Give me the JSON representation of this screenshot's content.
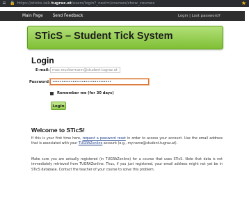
{
  "browser": {
    "menu_glyph": "≡",
    "lock_glyph": "🔒",
    "url_prefix": "https://sticks.iaik.",
    "url_domain": "tugraz.at",
    "url_suffix": "/users/login?_next=/courses/show_courses",
    "star_glyph": "★"
  },
  "navbar": {
    "main_page": "Main Page",
    "send_feedback": "Send Feedback",
    "login": "Login",
    "separator": " | ",
    "lost_password": "Lost password?"
  },
  "banner": {
    "title": "STicS – Student Tick System"
  },
  "login_form": {
    "heading": "Login",
    "email_label": "E-mail:",
    "email_placeholder": "max.muckermann@student.tugraz.at",
    "password_label": "Password:",
    "password_value": "••••••••••••••••••••••••••••••••",
    "remember_label": "Remember me (for 30 days)",
    "submit_label": "Login"
  },
  "welcome": {
    "heading": "Welcome to STicS!",
    "p1_a": "If this is your first time here, ",
    "p1_link1": "request a password reset",
    "p1_b": " in order to access your account. Use the email address that is associated with your ",
    "p1_link2": "TUGRAZonline",
    "p1_c": " account (e.g., my.name@student.tugraz.at).",
    "p2": "Make sure you are actually registered (in TUGRAZonline) for a course that uses STicS. Note that data is not immediately retrieved from TUGRAZonline. Thus, if you just registered, your email address might not yet be in STicS database. Contact the teacher of your course to solve this problem."
  }
}
